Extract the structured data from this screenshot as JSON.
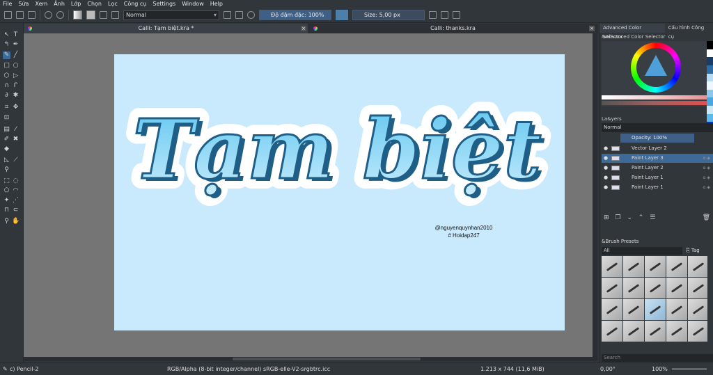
{
  "menu": [
    "File",
    "Sửa",
    "Xem",
    "Ảnh",
    "Lớp",
    "Chọn",
    "Lọc",
    "Công cụ",
    "Settings",
    "Window",
    "Help"
  ],
  "toolbar": {
    "blend_mode": "Normal",
    "opacity_label": "Độ đậm đặc: 100%",
    "size_label": "Size: 5,00 px",
    "fg_color": "#4d7fa8"
  },
  "tabs": [
    {
      "title": "Calli: Tạm biệt.kra *"
    },
    {
      "title": "Calli: thanks.kra"
    }
  ],
  "canvas": {
    "background": "#c9e9fd",
    "lettering": "Tạm biệt",
    "credit_line1": "@nguyenquynhan2010",
    "credit_line2": "# Hoidap247"
  },
  "right_panel": {
    "dock_tabs": [
      "Advanced Color Selector",
      "Cấu hình Công cụ"
    ],
    "color_title": "&Advanced Color Selector",
    "layers_title": "La&yers",
    "layer_blend": "Normal",
    "layer_opacity": "Opacity:  100%",
    "layers": [
      {
        "name": "Vector Layer 2",
        "selected": false
      },
      {
        "name": "Paint Layer 3",
        "selected": true
      },
      {
        "name": "Paint Layer 2",
        "selected": false
      },
      {
        "name": "Paint Layer 1",
        "selected": false
      },
      {
        "name": "Paint Layer 1",
        "selected": false
      }
    ],
    "brush_title": "&Brush Presets",
    "brush_filter": "All",
    "brush_tag": "Tag",
    "brush_search": "Search"
  },
  "status": {
    "brush": "c) Pencil-2",
    "color_space": "RGB/Alpha (8-bit integer/channel)  sRGB-elle-V2-srgbtrc.icc",
    "image_size": "1.213 x 744 (11,6 MiB)",
    "rotation": "0,00°",
    "zoom": "100%"
  }
}
